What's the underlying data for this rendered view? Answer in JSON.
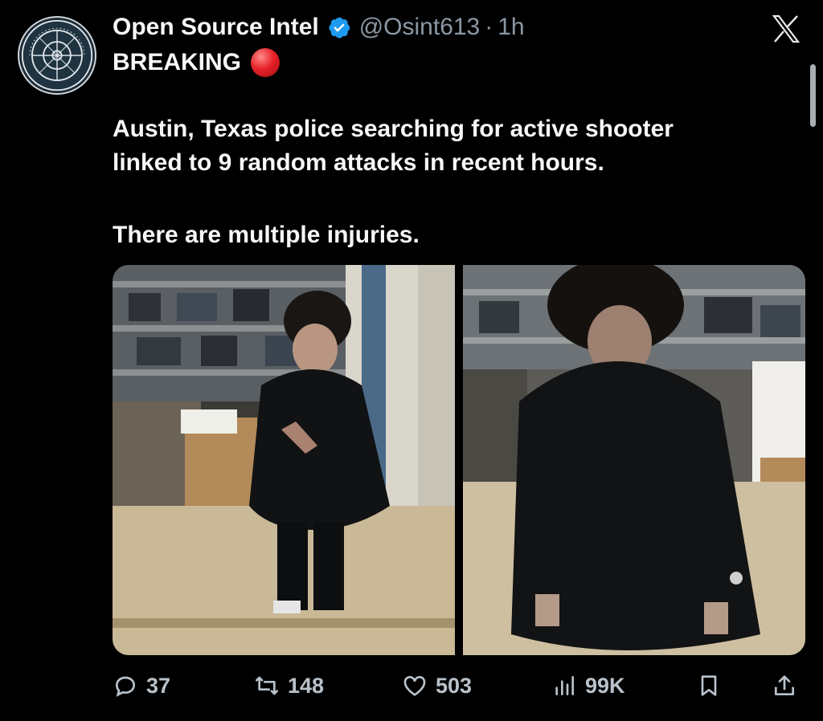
{
  "author": {
    "display_name": "Open Source Intel",
    "handle": "@Osint613",
    "separator": "·",
    "time": "1h",
    "verified": true,
    "avatar_icon": "osint-seal-logo",
    "avatar_ring_text": "OPEN SOURCE INTEL"
  },
  "tweet": {
    "headline": "BREAKING",
    "headline_icon": "red-circle-emoji",
    "paragraph_1_line_1": "Austin, Texas police searching for active shooter",
    "paragraph_1_line_2": "linked to 9 random attacks in recent hours.",
    "paragraph_2": "There are multiple injuries."
  },
  "media": {
    "images": [
      {
        "description_icon": "surveillance-photo-1"
      },
      {
        "description_icon": "surveillance-photo-2"
      }
    ]
  },
  "actions": {
    "reply_count": "37",
    "retweet_count": "148",
    "like_count": "503",
    "view_count": "99K",
    "icons": [
      "reply-icon",
      "retweet-icon",
      "like-icon",
      "views-icon",
      "bookmark-icon",
      "share-icon"
    ]
  },
  "colors": {
    "background": "#000000",
    "text": "#f5f7f8",
    "muted": "#8b98a5",
    "verified": "#1d9bf0",
    "icon": "#b9c2ca"
  }
}
